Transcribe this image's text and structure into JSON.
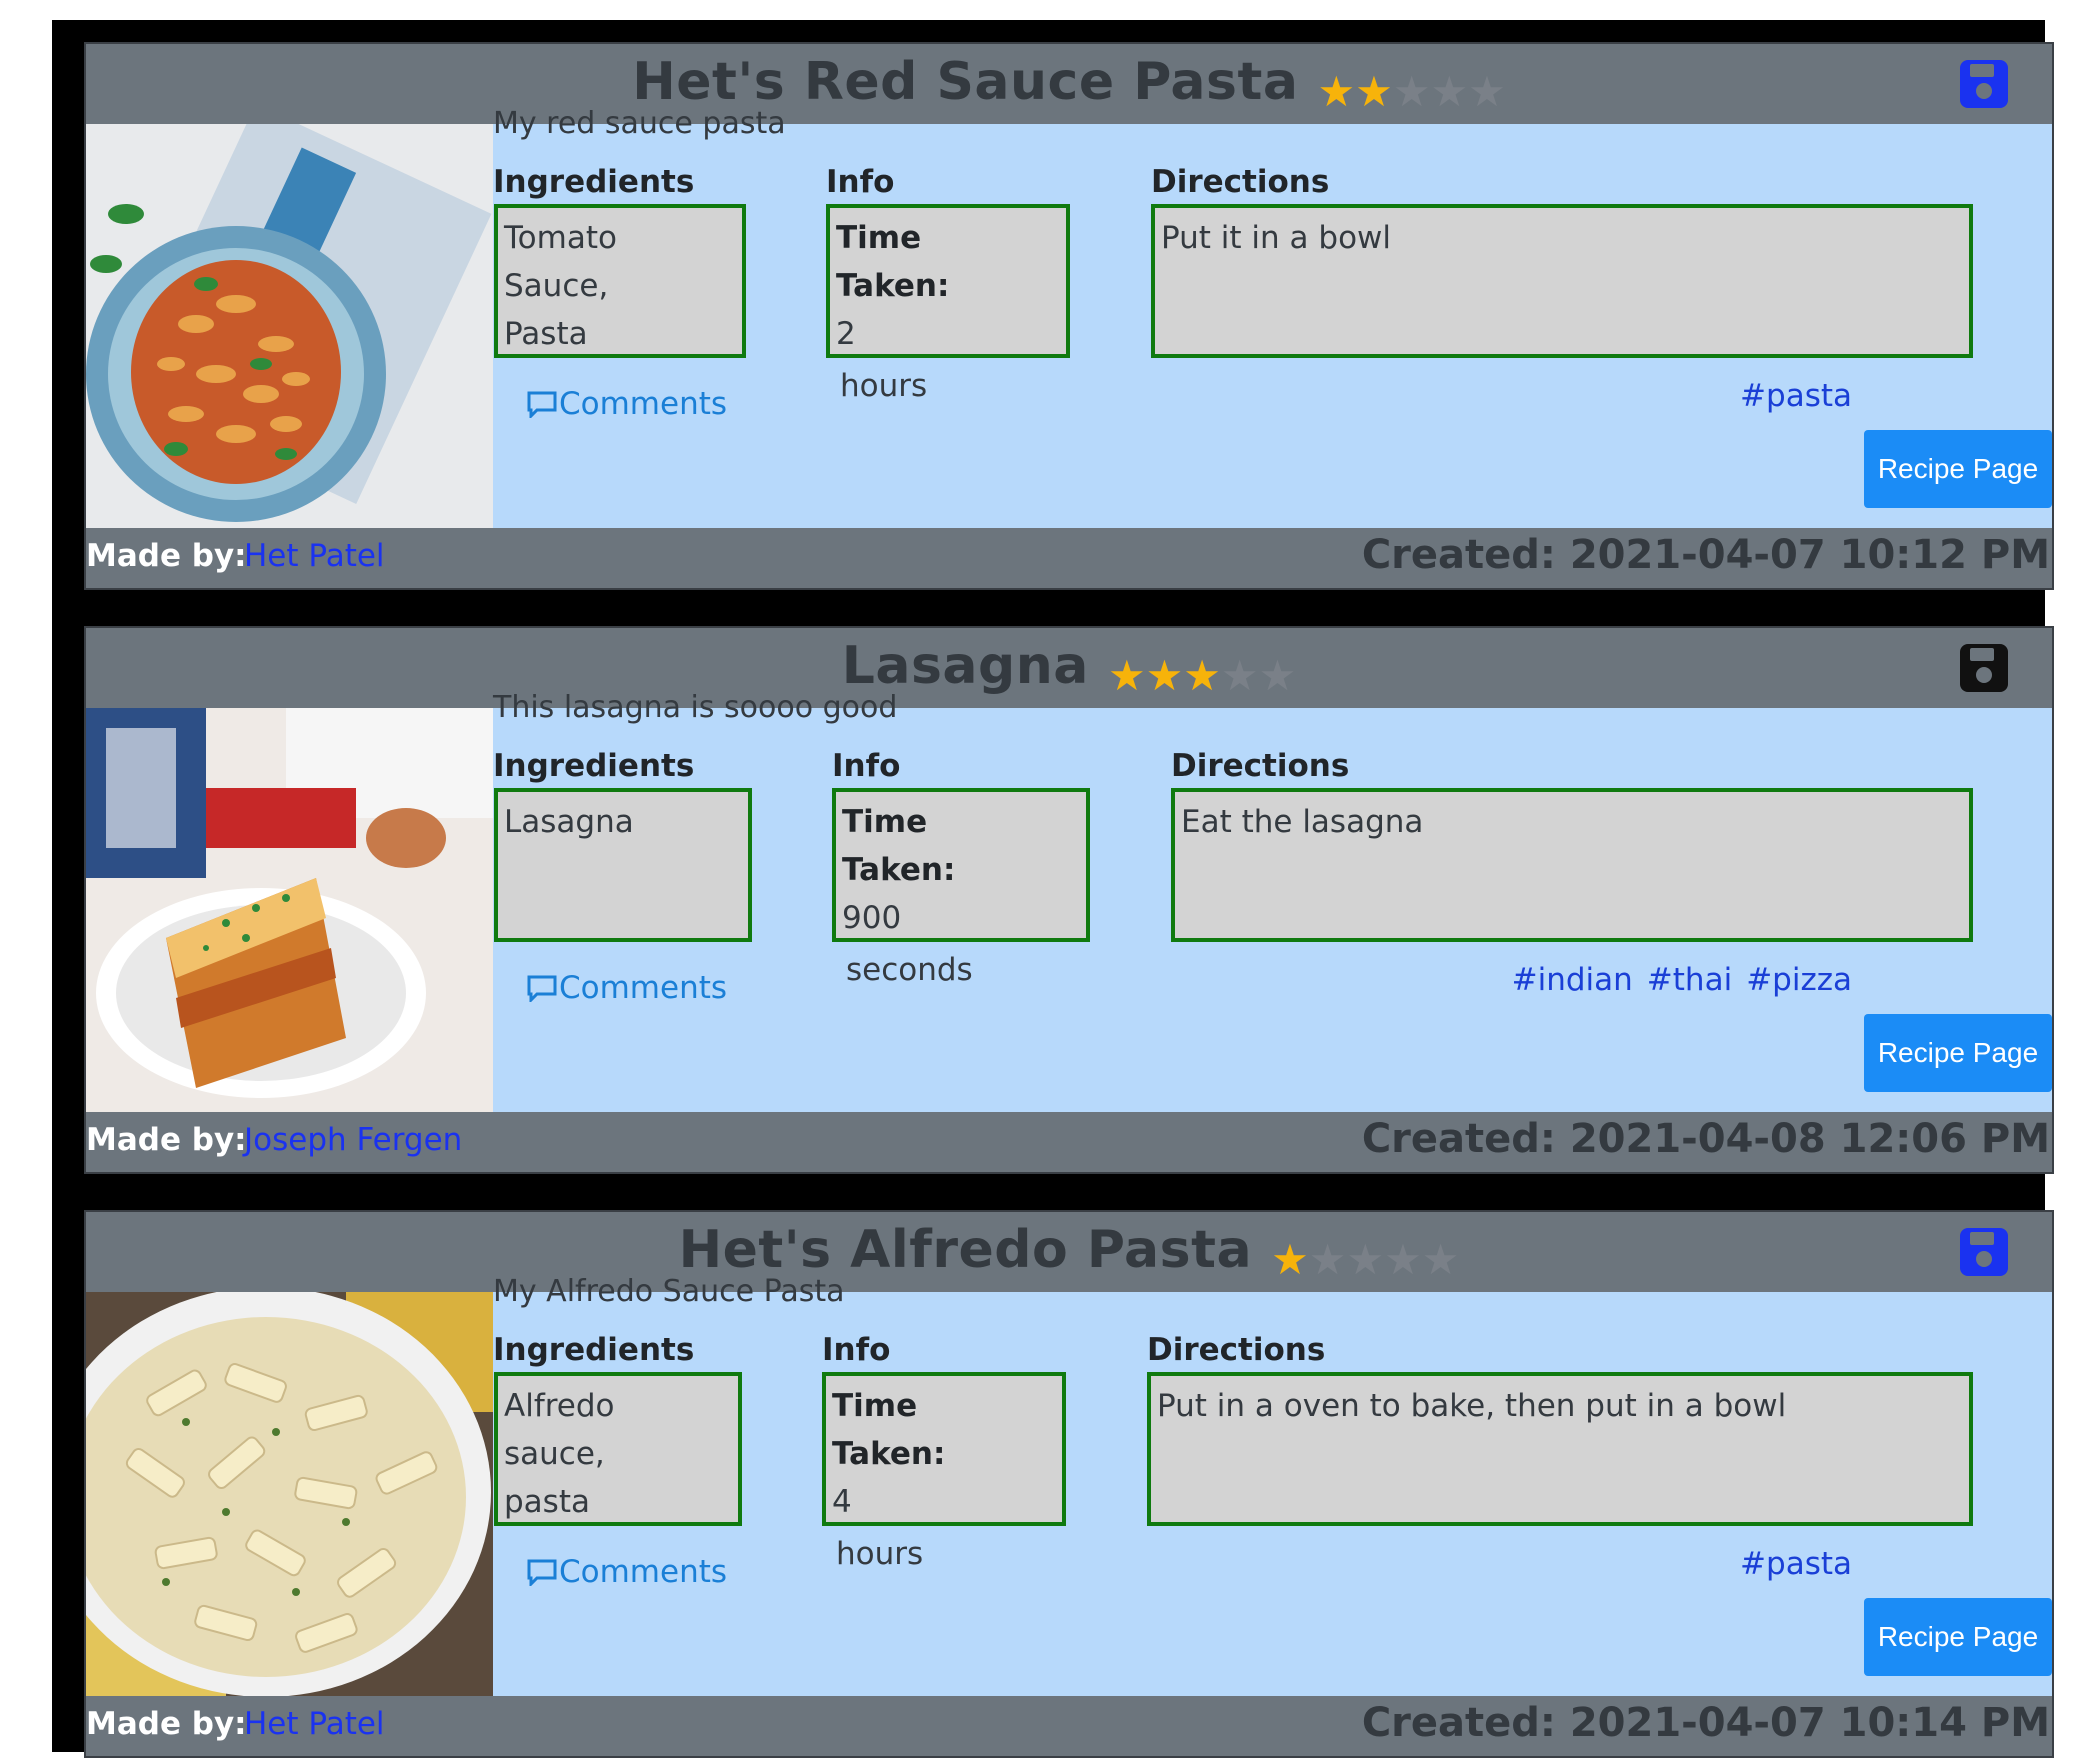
{
  "recipes": [
    {
      "title": "Het's Red Sauce Pasta",
      "rating": 2,
      "max_rating": 5,
      "save_icon_color": "#1a32f0",
      "description": "My red sauce pasta",
      "ingredients_label": "Ingredients",
      "ingredients": "Tomato Sauce, Pasta",
      "info_label": "Info",
      "time_label": "Time Taken:",
      "time_value": "2",
      "time_unit": "hours",
      "directions_label": "Directions",
      "directions": "Put it in a bowl",
      "comments_label": "Comments",
      "tags": [
        "#pasta"
      ],
      "recipe_button": "Recipe Page",
      "made_by_label": "Made by:",
      "author": "Het Patel",
      "created": "Created: 2021-04-07 10:12 PM",
      "image_icon": "pasta-photo"
    },
    {
      "title": "Lasagna",
      "rating": 3,
      "max_rating": 5,
      "save_icon_color": "#111111",
      "description": "This lasagna is soooo good",
      "ingredients_label": "Ingredients",
      "ingredients": "Lasagna",
      "info_label": "Info",
      "time_label": "Time Taken:",
      "time_value": "900",
      "time_unit": "seconds",
      "directions_label": "Directions",
      "directions": "Eat the lasagna",
      "comments_label": "Comments",
      "tags": [
        "#indian",
        "#thai",
        "#pizza"
      ],
      "recipe_button": "Recipe Page",
      "made_by_label": "Made by:",
      "author": "Joseph Fergen",
      "created": "Created: 2021-04-08 12:06 PM",
      "image_icon": "lasagna-photo"
    },
    {
      "title": "Het's Alfredo Pasta",
      "rating": 1,
      "max_rating": 5,
      "save_icon_color": "#1a32f0",
      "description": "My Alfredo Sauce Pasta",
      "ingredients_label": "Ingredients",
      "ingredients": "Alfredo sauce, pasta",
      "info_label": "Info",
      "time_label": "Time Taken:",
      "time_value": "4",
      "time_unit": "hours",
      "directions_label": "Directions",
      "directions": "Put in a oven to bake, then put in a bowl",
      "comments_label": "Comments",
      "tags": [
        "#pasta"
      ],
      "recipe_button": "Recipe Page",
      "made_by_label": "Made by:",
      "author": "Het Patel",
      "created": "Created: 2021-04-07 10:14 PM",
      "image_icon": "alfredo-photo"
    }
  ],
  "colors": {
    "card_body": "#b7d9fb",
    "card_header": "#6c757d",
    "star_on": "#f7b30a",
    "box_border": "#0f7a0f",
    "button": "#1b8cf6"
  }
}
